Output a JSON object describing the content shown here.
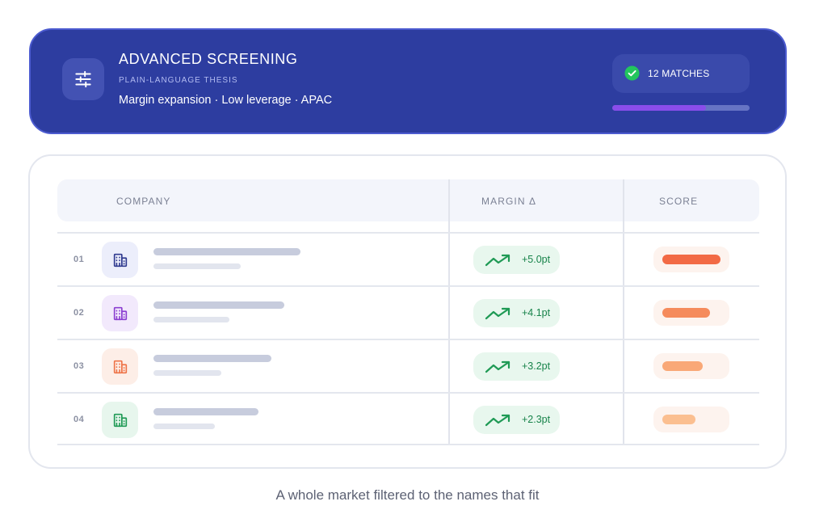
{
  "header": {
    "title": "ADVANCED SCREENING",
    "eyebrow": "PLAIN-LANGUAGE THESIS",
    "thesis": "Margin expansion · Low leverage · APAC",
    "icon": "sliders-icon",
    "matches_label": "12 MATCHES",
    "matches_icon": "check-circle-icon",
    "progress_fraction": 0.68,
    "colors": {
      "background": "#2d3da0",
      "check": "#22c55e",
      "progress": "#8a4dea"
    }
  },
  "table": {
    "columns": [
      "COMPANY",
      "MARGIN Δ",
      "SCORE"
    ],
    "rows": [
      {
        "rank": "01",
        "icon": "building-icon",
        "icon_color": "#2f3a8f",
        "icon_bg": "#eceefb",
        "margin": "+5.0pt",
        "trend_icon": "trending-up-icon",
        "score_fraction": 0.8,
        "score_color": "#f26a45"
      },
      {
        "rank": "02",
        "icon": "building-icon",
        "icon_color": "#8b3fd1",
        "icon_bg": "#f2e9fc",
        "margin": "+4.1pt",
        "trend_icon": "trending-up-icon",
        "score_fraction": 0.65,
        "score_color": "#f58b5c"
      },
      {
        "rank": "03",
        "icon": "building-icon",
        "icon_color": "#ee7448",
        "icon_bg": "#fdeee7",
        "margin": "+3.2pt",
        "trend_icon": "trending-up-icon",
        "score_fraction": 0.55,
        "score_color": "#f9a877"
      },
      {
        "rank": "04",
        "icon": "building-icon",
        "icon_color": "#1f9a55",
        "icon_bg": "#e7f6ed",
        "margin": "+2.3pt",
        "trend_icon": "trending-up-icon",
        "score_fraction": 0.45,
        "score_color": "#fbbf90"
      }
    ]
  },
  "caption": "A whole market filtered to the names that fit"
}
